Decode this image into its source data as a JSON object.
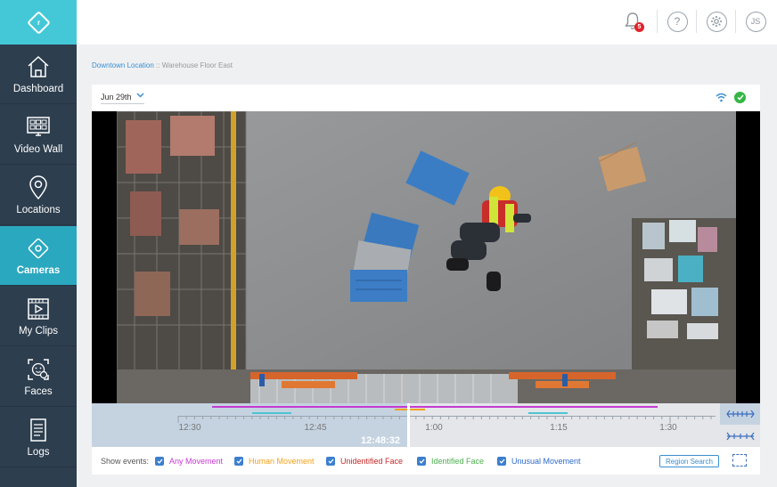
{
  "app": {
    "logo_glyph": "r"
  },
  "sidebar": {
    "items": [
      {
        "label": "Dashboard",
        "icon": "house-icon",
        "active": false
      },
      {
        "label": "Video Wall",
        "icon": "grid-monitor-icon",
        "active": false
      },
      {
        "label": "Locations",
        "icon": "map-pin-icon",
        "active": false
      },
      {
        "label": "Cameras",
        "icon": "camera-diamond-icon",
        "active": true
      },
      {
        "label": "My Clips",
        "icon": "film-play-icon",
        "active": false
      },
      {
        "label": "Faces",
        "icon": "face-scan-icon",
        "active": false
      },
      {
        "label": "Logs",
        "icon": "document-icon",
        "active": false
      }
    ]
  },
  "topbar": {
    "notification_count": "5",
    "help_glyph": "?",
    "user_initials": "JS"
  },
  "breadcrumb": {
    "location": "Downtown Location",
    "separator": " :: ",
    "camera": "Warehouse Floor East"
  },
  "player": {
    "date": "Jun 29th",
    "status": {
      "wifi": "wifi-icon",
      "online": "check-circle-icon"
    }
  },
  "timeline": {
    "tick_labels": [
      "12:30",
      "12:45",
      "1:00",
      "1:15",
      "1:30"
    ],
    "current_time": "12:48:32",
    "colors": {
      "past": "#c5d3e1",
      "future": "#e4e6e9"
    }
  },
  "filters": {
    "label": "Show events:",
    "items": [
      {
        "label": "Any Movement",
        "color": "#c43bd1",
        "checked": true
      },
      {
        "label": "Human Movement",
        "color": "#f2a11b",
        "checked": true
      },
      {
        "label": "Unidentified Face",
        "color": "#c62828",
        "checked": true
      },
      {
        "label": "Identified Face",
        "color": "#4caf50",
        "checked": true
      },
      {
        "label": "Unusual Movement",
        "color": "#2e6bc8",
        "checked": true
      }
    ],
    "region_search_label": "Region Search"
  },
  "colors": {
    "accent": "#2aa8bf",
    "logo_bg": "#44c8d8",
    "sidebar_bg": "#2d3e4e",
    "link": "#3a8fd0"
  }
}
